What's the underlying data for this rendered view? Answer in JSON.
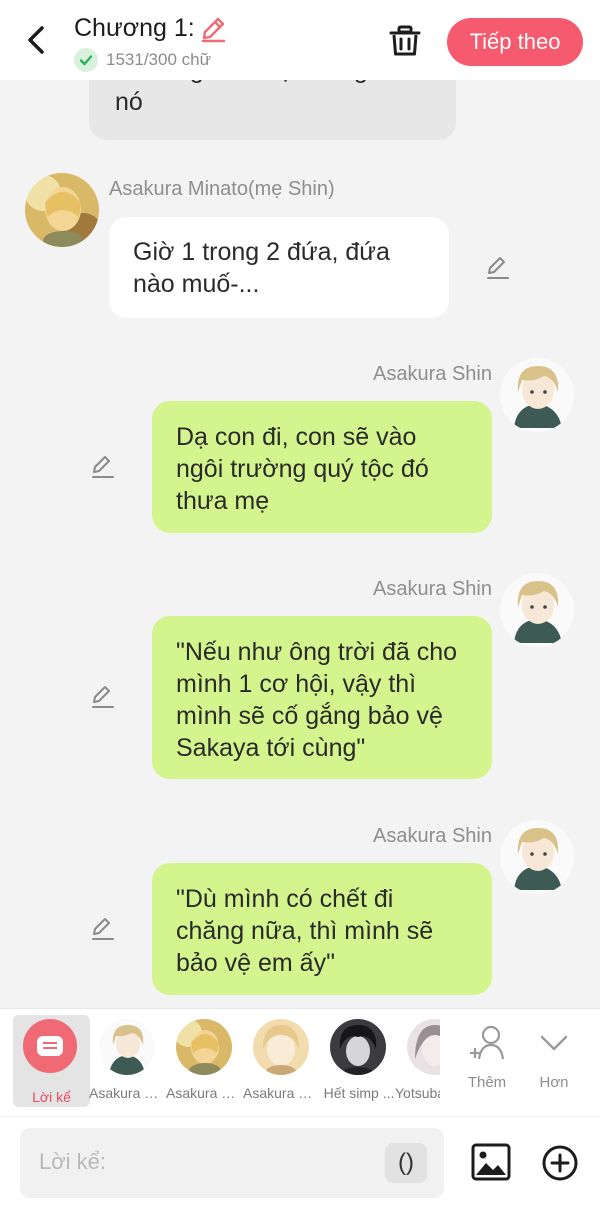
{
  "header": {
    "title": "Chương 1:",
    "word_count": "1531/300 chữ",
    "next_label": "Tiếp theo",
    "accent_color": "#f55a6e"
  },
  "messages": [
    {
      "type": "continued",
      "side": "left",
      "text": "nhường suất học bổng cho nó"
    },
    {
      "type": "message",
      "side": "left",
      "speaker": "Asakura Minato(mẹ Shin)",
      "text": "Giờ 1 trong 2 đứa, đứa nào muố-..."
    },
    {
      "type": "message",
      "side": "right",
      "speaker": "Asakura Shin",
      "text": "Dạ con đi, con sẽ vào ngôi trường quý tộc đó thưa mẹ"
    },
    {
      "type": "message",
      "side": "right",
      "speaker": "Asakura Shin",
      "text": "\"Nếu như ông trời đã cho mình 1 cơ hội, vậy thì mình sẽ cố gắng bảo vệ Sakaya tới cùng\""
    },
    {
      "type": "message",
      "side": "right",
      "speaker": "Asakura Shin",
      "text": "\"Dù mình có chết đi chăng nữa, thì mình sẽ bảo vệ em ấy\""
    }
  ],
  "character_bar": {
    "narration_label": "Lời kể",
    "characters": [
      {
        "name": "Asakura Shin"
      },
      {
        "name": "Asakura Minato"
      },
      {
        "name": "Asakura Sakaya"
      },
      {
        "name": "Hết simp ..."
      },
      {
        "name": "Yotsuba"
      }
    ],
    "add_label": "Thêm",
    "more_label": "Hơn"
  },
  "input": {
    "placeholder": "Lời kể:",
    "paren_label": "()"
  },
  "colors": {
    "own_bubble": "#d4f58e",
    "other_bubble": "#ffffff",
    "narration_accent": "#e64b5c"
  }
}
